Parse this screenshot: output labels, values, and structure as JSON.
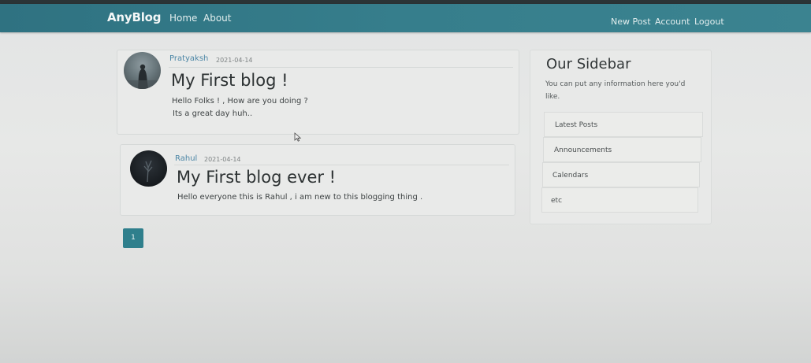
{
  "app": {
    "brand": "AnyBlog"
  },
  "nav": {
    "home": "Home",
    "about": "About",
    "new_post": "New Post",
    "account": "Account",
    "logout": "Logout"
  },
  "posts": [
    {
      "author": "Pratyaksh",
      "date": "2021-04-14",
      "title": "My First blog !",
      "lines": [
        "Hello Folks ! , How are you doing ?",
        "Its a great day huh.."
      ]
    },
    {
      "author": "Rahul",
      "date": "2021-04-14",
      "title": "My First blog ever !",
      "lines": [
        "Hello everyone this is Rahul , i am new to this blogging thing ."
      ]
    }
  ],
  "sidebar": {
    "title": "Our Sidebar",
    "description_lines": [
      "You can put any information here you'd",
      "like."
    ],
    "items": [
      "Latest Posts",
      "Announcements",
      "Calendars",
      "etc"
    ]
  },
  "pagination": {
    "current_page": "1"
  },
  "colors": {
    "navbar": "#367e8c",
    "accent": "#2f7f8c",
    "author_link": "#4d87a6"
  }
}
